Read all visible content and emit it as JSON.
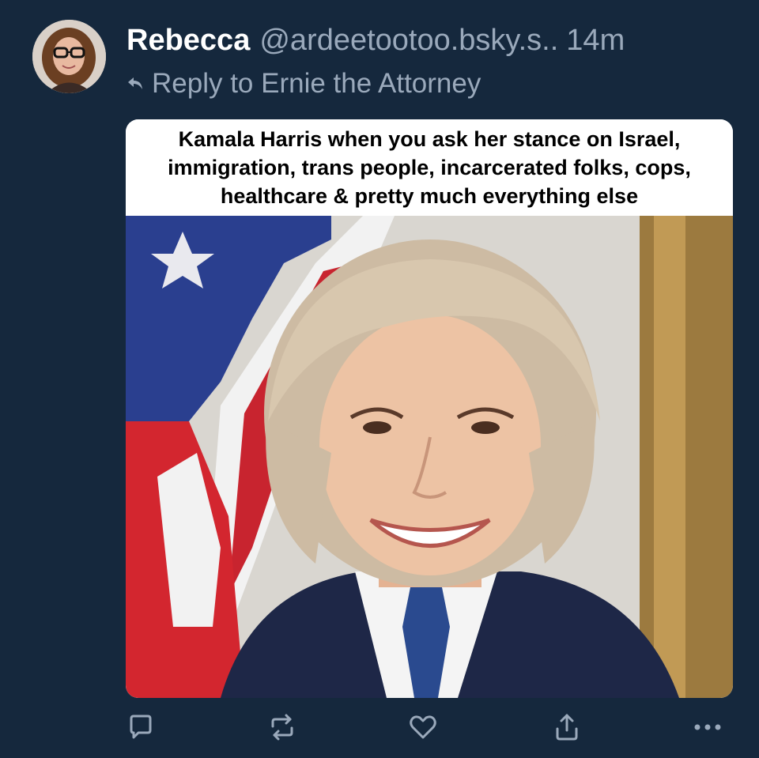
{
  "post": {
    "author": {
      "display_name": "Rebecca",
      "handle": "@ardeetootoo.bsky.s..",
      "timestamp": "14m"
    },
    "reply_to": {
      "label": "Reply to Ernie the Attorney",
      "icon": "reply-arrow-icon"
    },
    "embed": {
      "caption": "Kamala Harris when you ask her stance on Israel, immigration, trans people, incarcerated folks, cops, healthcare & pretty much everything else"
    },
    "actions": [
      {
        "name": "reply",
        "icon": "comment-icon"
      },
      {
        "name": "repost",
        "icon": "repost-icon"
      },
      {
        "name": "like",
        "icon": "heart-icon"
      },
      {
        "name": "share",
        "icon": "share-icon"
      },
      {
        "name": "more",
        "icon": "more-options-icon"
      }
    ]
  },
  "colors": {
    "background": "#15283d",
    "name_text": "#ffffff",
    "muted_text": "#9aa9bb",
    "icon": "#9aa9bb"
  }
}
